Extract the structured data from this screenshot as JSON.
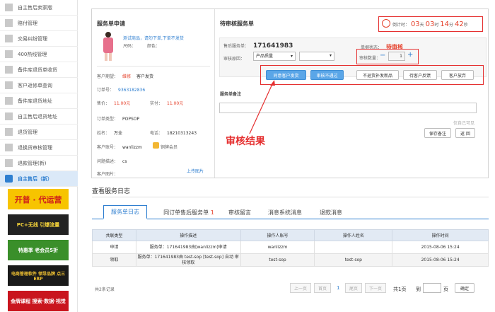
{
  "sidebar": {
    "items": [
      {
        "label": "自主售后卖家版"
      },
      {
        "label": "赔付管理"
      },
      {
        "label": "交易纠纷管理"
      },
      {
        "label": "400热线管理"
      },
      {
        "label": "备件库退货单收货"
      },
      {
        "label": "客户返修单查询"
      },
      {
        "label": "备件库退货地址"
      },
      {
        "label": "自主售后退货地址"
      },
      {
        "label": "退货管理"
      },
      {
        "label": "退换货审核管理"
      },
      {
        "label": "退款管理(新)"
      },
      {
        "label": "自主售后（新）"
      }
    ],
    "ads": [
      {
        "text": "开普 · 代运营"
      },
      {
        "text": "PC+无线 引爆流量"
      },
      {
        "text": "特惠季 老会员5折"
      },
      {
        "text": "电商管理软件 领导品牌 点三ERP"
      },
      {
        "text": "金牌课程 搜索·数据·视觉"
      }
    ]
  },
  "apply": {
    "title": "服务单申请",
    "product_desc": "测试商品，请勿下单,下单不发货",
    "size_label": "尺码：",
    "color_label": "颜色：",
    "fields": [
      {
        "label": "客户期望：",
        "value": "维修",
        "extra": "客户发货"
      },
      {
        "label": "订单号：",
        "value": "9363182836"
      },
      {
        "label": "售价：",
        "value": "11.00元",
        "label2": "实付：",
        "value2": "11.00元"
      },
      {
        "label": "订单类型：",
        "value": "POPSOP"
      },
      {
        "label": "姓名：",
        "value": "万全",
        "label2": "电话：",
        "value2": "18210313243"
      },
      {
        "label": "客户账号：",
        "value": "wanlizzm",
        "extra": "铜牌会员"
      },
      {
        "label": "问题描述：",
        "value": "cs"
      },
      {
        "label": "客户图片：",
        "value": ""
      }
    ],
    "upload_link": "上传图片"
  },
  "review": {
    "title": "待审核服务单",
    "service_no_label": "售后服务单：",
    "service_no": "171641983",
    "status_label": "单据状态：",
    "status": "待审核",
    "type_label": "审核原因：",
    "type_value": "产品质量",
    "qty_label": "审核数量：",
    "qty_minus": "−",
    "qty_value": "1",
    "qty_plus": "+",
    "countdown": {
      "prefix": "倒计时：",
      "days": "03",
      "days_unit": "天",
      "hours": "03",
      "hours_unit": "时",
      "minutes": "14",
      "minutes_unit": "分",
      "seconds": "42",
      "seconds_unit": "秒"
    },
    "buttons": [
      "同意客户发货",
      "审核不通过",
      "不退货补发新品",
      "待客户反馈",
      "客户放弃"
    ],
    "remark_label": "服务单备注",
    "remark_placeholder": "",
    "hint": "仅自己可见",
    "save_remark": "保存备注",
    "back": "返 回",
    "annotation": "审核结果"
  },
  "log": {
    "title": "查看服务日志",
    "tabs": [
      {
        "label": "服务单日志"
      },
      {
        "label": "同订单售后服务单",
        "count": "1"
      },
      {
        "label": "审核留言"
      },
      {
        "label": "消息系统消息"
      },
      {
        "label": "退款消息"
      }
    ],
    "columns": [
      "共联类型",
      "操作描述",
      "操作人账号",
      "操作人姓名",
      "操作时间"
    ],
    "rows": [
      {
        "type": "申请",
        "desc": "服务单：171641983由[wanlizzm]申请",
        "account": "wanlizzm",
        "name": "",
        "time": "2015-08-06 15:24"
      },
      {
        "type": "领取",
        "desc": "服务单：171641983由 test-sop [test-sop] 自动 审核领取",
        "account": "test-sop",
        "name": "test-sop",
        "time": "2015-08-06 15:24"
      }
    ],
    "total": "共2条记录",
    "pager": {
      "first": "上一页",
      "prev": "首页",
      "current": "1",
      "last": "尾页",
      "next": "下一页",
      "pages": "共1页",
      "goto_label": "到",
      "page_unit": "页",
      "confirm": "确定"
    }
  },
  "colors": {
    "accent": "#2f7fd0",
    "red": "#e53030",
    "header_bg": "#e2eaf4"
  }
}
